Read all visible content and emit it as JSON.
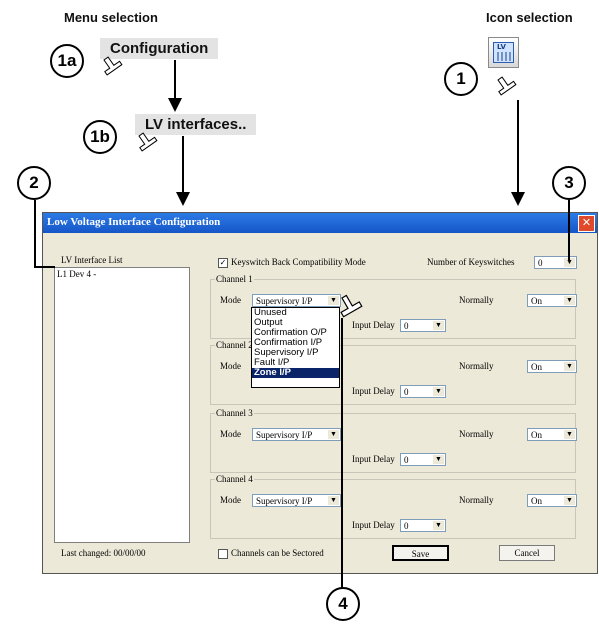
{
  "headers": {
    "menu_selection": "Menu selection",
    "icon_selection": "Icon  selection"
  },
  "menu": {
    "configuration": "Configuration",
    "lv_interfaces": "LV interfaces.."
  },
  "callouts": [
    "1a",
    "1b",
    "1",
    "2",
    "3",
    "4"
  ],
  "toolbar_icon": {
    "name": "lv-interface-icon",
    "text": "LV"
  },
  "dialog": {
    "title": "Low Voltage Interface Configuration",
    "close": "✕",
    "list_label": "LV Interface List",
    "list_items": [
      "L1 Dev 4 -"
    ],
    "keyswitch_compat": {
      "label": "Keyswitch Back Compatibility Mode",
      "checked": true
    },
    "num_keyswitches": {
      "label": "Number of Keyswitches",
      "value": "0"
    },
    "mode_label": "Mode",
    "normally_label": "Normally",
    "input_delay_label": "Input Delay",
    "channels": [
      {
        "label": "Channel 1",
        "mode": "Supervisory I/P",
        "normally": "On",
        "input_delay": "0"
      },
      {
        "label": "Channel 2",
        "mode": "Supervisory I/P",
        "normally": "On",
        "input_delay": "0"
      },
      {
        "label": "Channel 3",
        "mode": "Supervisory I/P",
        "normally": "On",
        "input_delay": "0"
      },
      {
        "label": "Channel 4",
        "mode": "Supervisory I/P",
        "normally": "On",
        "input_delay": "0"
      }
    ],
    "mode_options": [
      "Unused",
      "Output",
      "Confirmation O/P",
      "Confirmation I/P",
      "Supervisory I/P",
      "Fault I/P",
      "Zone I/P"
    ],
    "mode_selected": "Zone I/P",
    "last_changed": "Last changed: 00/00/00",
    "sectored": {
      "label": "Channels can be Sectored",
      "checked": false
    },
    "save": "Save",
    "cancel": "Cancel"
  },
  "colors": {
    "titlebar": "#1656c8",
    "dialog_bg": "#ece9d8",
    "selection": "#0a246a",
    "menu_bg": "#e3e3e3"
  }
}
